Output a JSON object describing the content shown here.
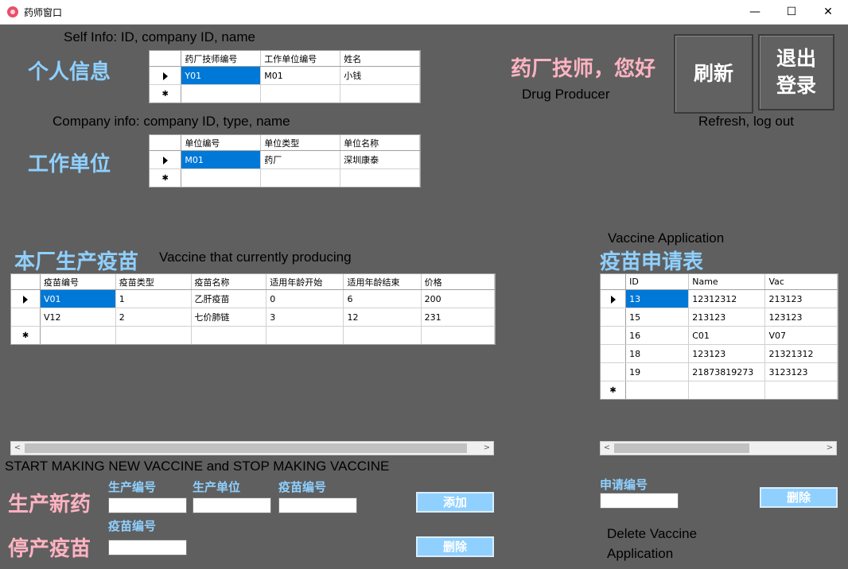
{
  "window": {
    "title": "药师窗口",
    "minimize": "—",
    "maximize": "☐",
    "close": "✕"
  },
  "notes": {
    "self_info": "Self Info: ID, company ID, name",
    "company_info": "Company info: company ID, type, name",
    "drug_producer": "Drug Producer",
    "refresh_logout": "Refresh, log out",
    "vaccine_producing": "Vaccine that currently producing",
    "vaccine_application": "Vaccine Application",
    "start_stop": "START MAKING NEW VACCINE and STOP MAKING VACCINE",
    "delete_application_1": "Delete Vaccine",
    "delete_application_2": "Application"
  },
  "headings": {
    "personal_info": "个人信息",
    "work_unit": "工作单位",
    "greeting": "药厂技师，您好",
    "factory_vaccines": "本厂生产疫苗",
    "application_table": "疫苗申请表",
    "produce_new": "生产新药",
    "stop_produce": "停产疫苗"
  },
  "buttons": {
    "refresh": "刷新",
    "logout": "退出登录",
    "add": "添加",
    "delete_vaccine": "删除",
    "delete_application": "删除"
  },
  "form_labels": {
    "production_id": "生产编号",
    "production_unit": "生产单位",
    "vaccine_id": "疫苗编号",
    "stop_vaccine_id": "疫苗编号",
    "application_id": "申请编号"
  },
  "personal_grid": {
    "columns": [
      "药厂技师编号",
      "工作单位编号",
      "姓名"
    ],
    "rows": [
      [
        "Y01",
        "M01",
        "小钱"
      ]
    ]
  },
  "company_grid": {
    "columns": [
      "单位编号",
      "单位类型",
      "单位名称"
    ],
    "rows": [
      [
        "M01",
        "药厂",
        "深圳康泰"
      ]
    ]
  },
  "vaccine_grid": {
    "columns": [
      "疫苗编号",
      "疫苗类型",
      "疫苗名称",
      "适用年龄开始",
      "适用年龄结束",
      "价格"
    ],
    "rows": [
      [
        "V01",
        "1",
        "乙肝疫苗",
        "0",
        "6",
        "200"
      ],
      [
        "V12",
        "2",
        "七价肺链",
        "3",
        "12",
        "231"
      ]
    ]
  },
  "application_grid": {
    "columns": [
      "ID",
      "Name",
      "Vac"
    ],
    "rows": [
      [
        "13",
        "12312312",
        "213123"
      ],
      [
        "15",
        "213123",
        "123123"
      ],
      [
        "16",
        " C01",
        " V07"
      ],
      [
        "18",
        " 123123",
        " 21321312"
      ],
      [
        "19",
        " 21873819273",
        " 3123123"
      ]
    ]
  },
  "grid_markers": {
    "current_row": "▶",
    "new_row": "✱",
    "scroll_left": "<",
    "scroll_right": ">"
  },
  "colors": {
    "background": "#5f5f5f",
    "accent_blue": "#8fd0ff",
    "accent_pink": "#ffb3c2",
    "selection": "#0078d7"
  }
}
